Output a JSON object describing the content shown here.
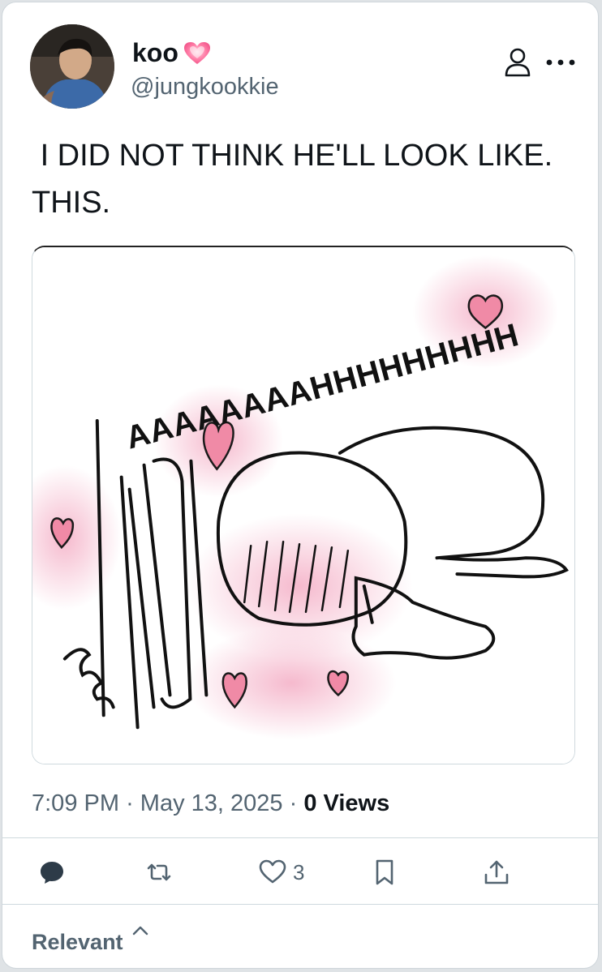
{
  "tweet": {
    "display_name": "koo",
    "name_emoji_icon": "pink-heart-icon",
    "handle": "@jungkookkie",
    "text": " I DID NOT THINK HE'LL LOOK LIKE.\nTHIS.",
    "media": {
      "caption_text": "AAAAAAAAHHHHHHHHH"
    },
    "time": "7:09 PM",
    "date": "May 13, 2025",
    "separator": "·",
    "views_count": "0",
    "views_label": "Views"
  },
  "actions": {
    "reply_icon": "reply-icon",
    "retweet_icon": "retweet-icon",
    "like_icon": "heart-icon",
    "like_count": "3",
    "bookmark_icon": "bookmark-icon",
    "share_icon": "share-icon"
  },
  "replies_sort": {
    "label": "Relevant",
    "icon": "chevron-up-icon"
  },
  "colors": {
    "text": "#0f1419",
    "secondary": "#536471",
    "border": "#cfd9de",
    "heart_pink": "#f07c9c"
  }
}
